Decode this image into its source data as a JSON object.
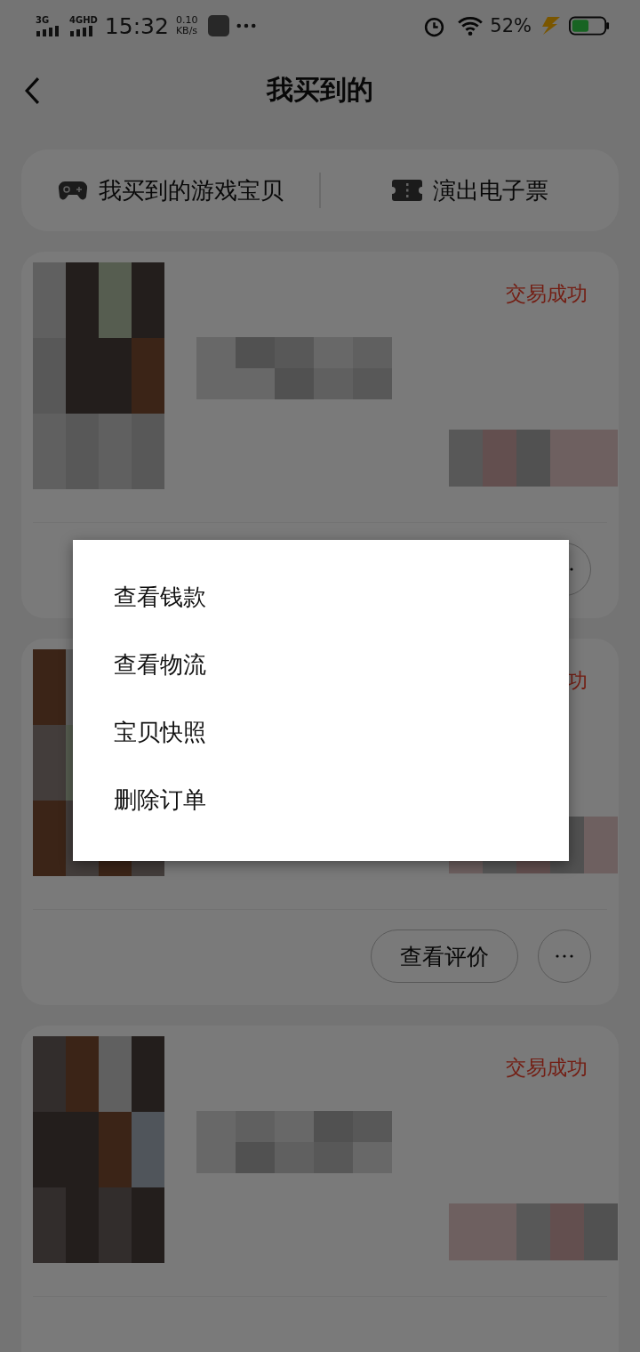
{
  "status_bar": {
    "network_1": "3G",
    "network_2": "4GHD",
    "time": "15:32",
    "speed": "0.10",
    "speed_unit": "KB/s",
    "battery": "52%"
  },
  "header": {
    "title": "我买到的"
  },
  "shortcuts": [
    {
      "label": "我买到的游戏宝贝",
      "kind": "game"
    },
    {
      "label": "演出电子票",
      "kind": "ticket"
    }
  ],
  "orders": [
    {
      "status": "交易成功",
      "more": true
    },
    {
      "status": "功",
      "buttons": [
        "查看评价"
      ],
      "more": true
    },
    {
      "status": "交易成功",
      "more": false
    }
  ],
  "menu": {
    "items": [
      "查看钱款",
      "查看物流",
      "宝贝快照",
      "删除订单"
    ]
  }
}
